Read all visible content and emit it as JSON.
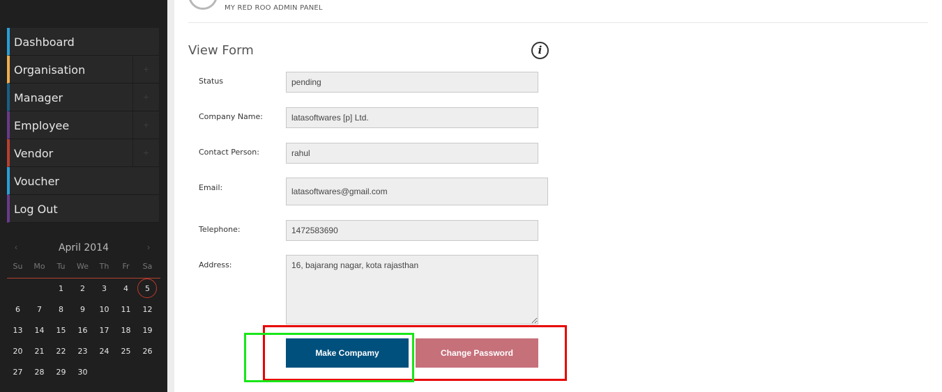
{
  "header": {
    "subtitle": "MY RED ROO ADMIN PANEL"
  },
  "sidebar": {
    "items": [
      {
        "label": "Dashboard",
        "accent": "#2a9fd6",
        "expandable": false
      },
      {
        "label": "Organisation",
        "accent": "#f0ad4e",
        "expandable": true
      },
      {
        "label": "Manager",
        "accent": "#1a5e86",
        "expandable": true
      },
      {
        "label": "Employee",
        "accent": "#6a3a8c",
        "expandable": true
      },
      {
        "label": "Vendor",
        "accent": "#b84030",
        "expandable": true
      },
      {
        "label": "Voucher",
        "accent": "#2a9fd6",
        "expandable": false
      },
      {
        "label": "Log Out",
        "accent": "#6a3a8c",
        "expandable": false
      }
    ],
    "expand_icon": "plus-icon"
  },
  "calendar": {
    "prev": "‹",
    "next": "›",
    "title": "April 2014",
    "weekdays": [
      "Su",
      "Mo",
      "Tu",
      "We",
      "Th",
      "Fr",
      "Sa"
    ],
    "first_weekday_index": 2,
    "days": 30,
    "today": 5
  },
  "form": {
    "title": "View Form",
    "info_icon": "info-icon",
    "fields": {
      "status": {
        "label": "Status",
        "value": "pending"
      },
      "company": {
        "label": "Company Name:",
        "value": "latasoftwares [p] Ltd."
      },
      "contact": {
        "label": "Contact Person:",
        "value": "rahul"
      },
      "email": {
        "label": "Email:",
        "value": "latasoftwares@gmail.com"
      },
      "telephone": {
        "label": "Telephone:",
        "value": "1472583690"
      },
      "address": {
        "label": "Address:",
        "value": "16, bajarang nagar, kota rajasthan"
      }
    },
    "buttons": {
      "make_company": "Make Compamy",
      "change_password": "Change Password"
    }
  },
  "colors": {
    "sidebar_bg": "#1f1f1f",
    "primary_button": "#00507d",
    "secondary_button": "#c6707a",
    "annotation_red": "#e80000",
    "annotation_green": "#18e618"
  }
}
